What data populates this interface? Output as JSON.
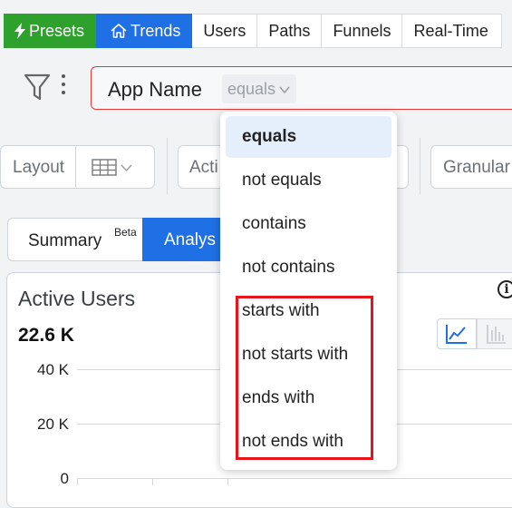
{
  "nav": {
    "items": [
      {
        "label": "Presets"
      },
      {
        "label": "Trends"
      },
      {
        "label": "Users"
      },
      {
        "label": "Paths"
      },
      {
        "label": "Funnels"
      },
      {
        "label": "Real-Time"
      }
    ],
    "colors": {
      "presets": "#2ea12c",
      "trends": "#1f6fe5"
    }
  },
  "filter": {
    "field": "App Name",
    "operator": "equals",
    "border_color": "#e53935"
  },
  "controls": {
    "layout_label": "Layout",
    "metric_label": "Acti",
    "granularity_label": "Granular"
  },
  "tabs": {
    "summary": "Summary",
    "summary_badge": "Beta",
    "analysis": "Analys"
  },
  "card": {
    "title": "Active Users",
    "value": "22.6 K",
    "y_ticks": [
      "40 K",
      "20 K",
      "0"
    ]
  },
  "dropdown": {
    "options": [
      {
        "label": "equals",
        "selected": true
      },
      {
        "label": "not equals",
        "selected": false
      },
      {
        "label": "contains",
        "selected": false
      },
      {
        "label": "not contains",
        "selected": false
      },
      {
        "label": "starts with",
        "selected": false
      },
      {
        "label": "not starts with",
        "selected": false
      },
      {
        "label": "ends with",
        "selected": false
      },
      {
        "label": "not ends with",
        "selected": false
      }
    ],
    "highlight_color": "#e8141b"
  },
  "icons": {
    "presets": "lightning-icon",
    "trends": "home-icon",
    "filter": "funnel-icon",
    "menu": "kebab-icon",
    "layout": "grid-icon",
    "info": "info-icon",
    "line_chart": "line-chart-icon",
    "bar_chart": "bar-chart-icon"
  }
}
